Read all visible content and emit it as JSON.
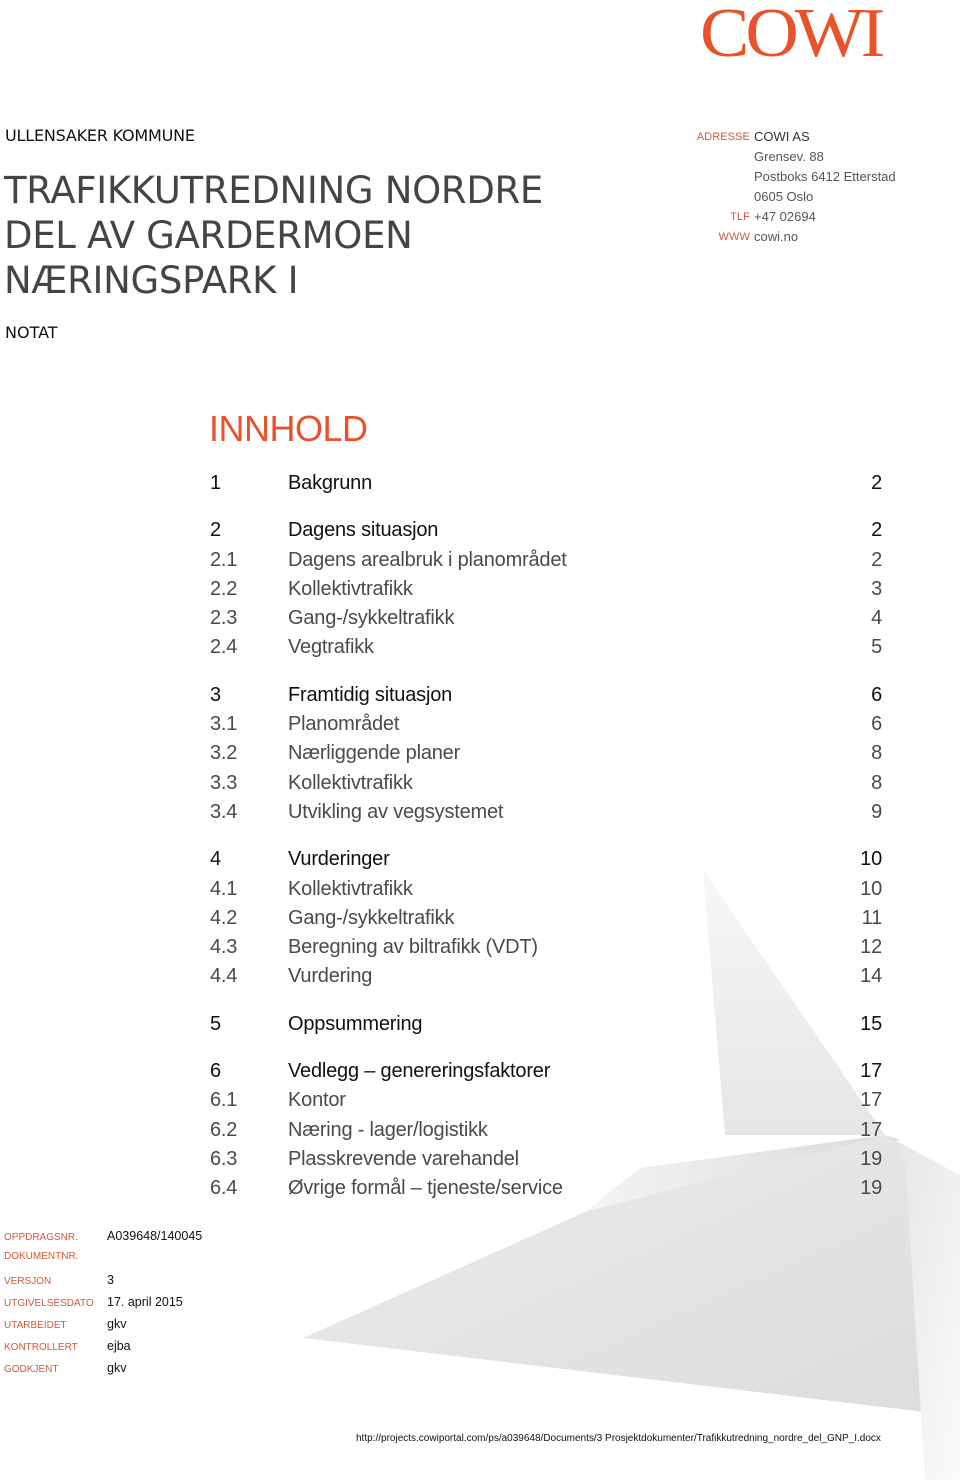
{
  "logo": {
    "text": "COWI",
    "color": "#e8532b"
  },
  "header": {
    "client": "ULLENSAKER KOMMUNE",
    "title_lines": [
      "TRAFIKKUTREDNING NORDRE",
      "DEL AV GARDERMOEN",
      "NÆRINGSPARK I"
    ],
    "document_type": "NOTAT"
  },
  "address": {
    "rows": [
      {
        "label": "ADRESSE",
        "value": "COWI AS"
      },
      {
        "label": "",
        "value": "Grensev. 88"
      },
      {
        "label": "",
        "value": "Postboks 6412 Etterstad"
      },
      {
        "label": "",
        "value": "0605 Oslo"
      },
      {
        "label": "TLF",
        "value": "+47 02694"
      },
      {
        "label": "WWW",
        "value": "cowi.no"
      }
    ]
  },
  "toc": {
    "heading": "INNHOLD",
    "groups": [
      {
        "entries": [
          {
            "num": "1",
            "label": "Bakgrunn",
            "page": "2",
            "level": 1
          }
        ]
      },
      {
        "entries": [
          {
            "num": "2",
            "label": "Dagens situasjon",
            "page": "2",
            "level": 1
          },
          {
            "num": "2.1",
            "label": "Dagens arealbruk i planområdet",
            "page": "2",
            "level": 2
          },
          {
            "num": "2.2",
            "label": "Kollektivtrafikk",
            "page": "3",
            "level": 2
          },
          {
            "num": "2.3",
            "label": "Gang-/sykkeltrafikk",
            "page": "4",
            "level": 2
          },
          {
            "num": "2.4",
            "label": "Vegtrafikk",
            "page": "5",
            "level": 2
          }
        ]
      },
      {
        "entries": [
          {
            "num": "3",
            "label": "Framtidig situasjon",
            "page": "6",
            "level": 1
          },
          {
            "num": "3.1",
            "label": "Planområdet",
            "page": "6",
            "level": 2
          },
          {
            "num": "3.2",
            "label": "Nærliggende planer",
            "page": "8",
            "level": 2
          },
          {
            "num": "3.3",
            "label": "Kollektivtrafikk",
            "page": "8",
            "level": 2
          },
          {
            "num": "3.4",
            "label": "Utvikling av vegsystemet",
            "page": "9",
            "level": 2
          }
        ]
      },
      {
        "entries": [
          {
            "num": "4",
            "label": "Vurderinger",
            "page": "10",
            "level": 1
          },
          {
            "num": "4.1",
            "label": "Kollektivtrafikk",
            "page": "10",
            "level": 2
          },
          {
            "num": "4.2",
            "label": "Gang-/sykkeltrafikk",
            "page": "11",
            "level": 2
          },
          {
            "num": "4.3",
            "label": "Beregning av biltrafikk (VDT)",
            "page": "12",
            "level": 2
          },
          {
            "num": "4.4",
            "label": "Vurdering",
            "page": "14",
            "level": 2
          }
        ]
      },
      {
        "entries": [
          {
            "num": "5",
            "label": "Oppsummering",
            "page": "15",
            "level": 1
          }
        ]
      },
      {
        "entries": [
          {
            "num": "6",
            "label": "Vedlegg – genereringsfaktorer",
            "page": "17",
            "level": 1
          },
          {
            "num": "6.1",
            "label": "Kontor",
            "page": "17",
            "level": 2
          },
          {
            "num": "6.2",
            "label": "Næring - lager/logistikk",
            "page": "17",
            "level": 2
          },
          {
            "num": "6.3",
            "label": "Plasskrevende varehandel",
            "page": "19",
            "level": 2
          },
          {
            "num": "6.4",
            "label": "Øvrige formål – tjeneste/service",
            "page": "19",
            "level": 2
          }
        ]
      }
    ]
  },
  "metadata": [
    {
      "label": "OPPDRAGSNR.",
      "value": "A039648/140045"
    },
    {
      "label": "DOKUMENTNR.",
      "value": ""
    },
    {
      "label": "VERSJON",
      "value": "3"
    },
    {
      "label": "UTGIVELSESDATO",
      "value": "17. april 2015"
    },
    {
      "label": "UTARBEIDET",
      "value": "gkv"
    },
    {
      "label": "KONTROLLERT",
      "value": "ejba"
    },
    {
      "label": "GODKJENT",
      "value": "gkv"
    }
  ],
  "footer": {
    "path": "http://projects.cowiportal.com/ps/a039648/Documents/3 Prosjektdokumenter/Trafikkutredning_nordre_del_GNP_I.docx"
  },
  "colors": {
    "accent": "#e8532b",
    "label_accent": "#d2593a",
    "title_gray": "#444444"
  }
}
